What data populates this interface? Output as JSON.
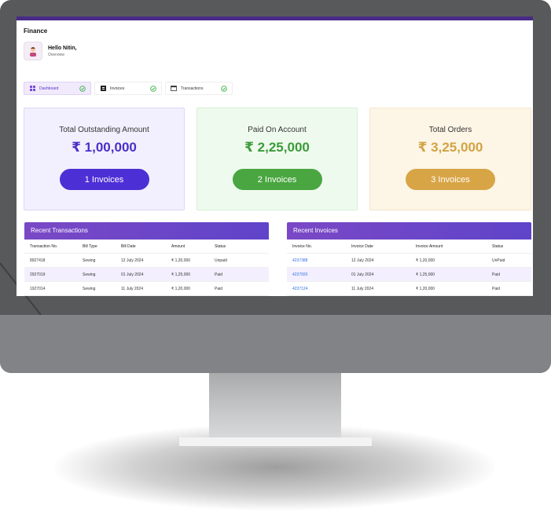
{
  "app": {
    "brand": "Finance"
  },
  "user": {
    "greeting": "Hello Nitin,",
    "subtitle": "Overview"
  },
  "tabs": [
    {
      "label": "Dashboard",
      "icon": "grid-icon",
      "active": true
    },
    {
      "label": "Invoices",
      "icon": "invoice-icon",
      "active": false
    },
    {
      "label": "Transactions",
      "icon": "transactions-icon",
      "active": false
    }
  ],
  "cards": [
    {
      "title": "Total Outstanding Amount",
      "value": "₹ 1,00,000",
      "button": "1 Invoices",
      "color": "#4d2fd6"
    },
    {
      "title": "Paid On Account",
      "value": "₹ 2,25,000",
      "button": "2 Invoices",
      "color": "#4aa640"
    },
    {
      "title": "Total Orders",
      "value": "₹ 3,25,000",
      "button": "3 Invoices",
      "color": "#d8a546"
    }
  ],
  "recent_transactions": {
    "title": "Recent Transactions",
    "columns": [
      "Transaction No.",
      "Bill Type",
      "Bill Date",
      "Amount",
      "Status"
    ],
    "rows": [
      [
        "8927418",
        "Sewing",
        "12 July 2024",
        "₹ 1,20,000",
        "Unpaid"
      ],
      [
        "2927019",
        "Sewing",
        "01 July 2024",
        "₹ 1,25,000",
        "Paid"
      ],
      [
        "1927014",
        "Sewing",
        "11 July 2024",
        "₹ 1,20,000",
        "Paid"
      ]
    ]
  },
  "recent_invoices": {
    "title": "Recent Invoices",
    "columns": [
      "Invoice No.",
      "Invoice Date",
      "Invoice Amount",
      "Status"
    ],
    "rows": [
      [
        "4237388",
        "12 July 2024",
        "₹ 1,20,000",
        "UnPaid"
      ],
      [
        "4237920",
        "01 July 2024",
        "₹ 1,25,000",
        "Paid"
      ],
      [
        "4237124",
        "11 July 2024",
        "₹ 1,20,000",
        "Paid"
      ]
    ]
  }
}
